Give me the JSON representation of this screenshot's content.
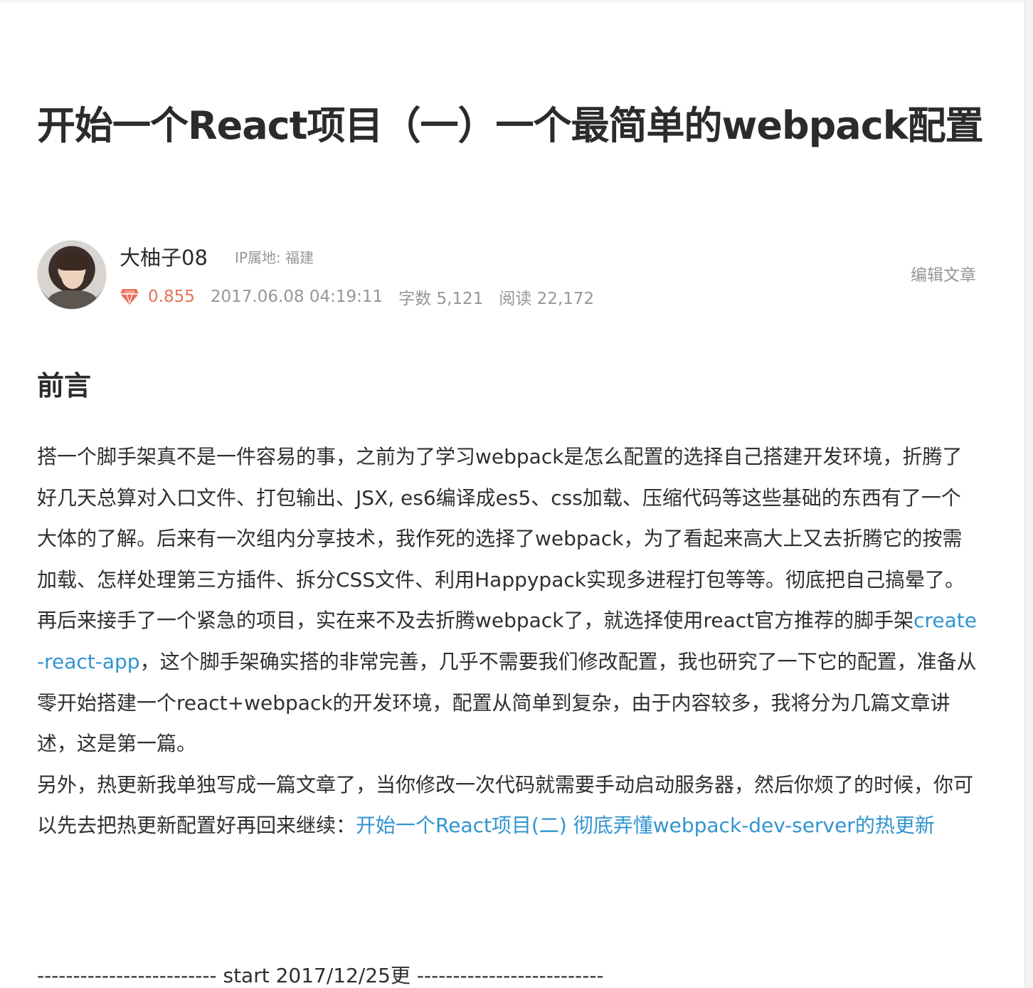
{
  "article": {
    "title": "开始一个React项目（一）一个最简单的webpack配置"
  },
  "author": {
    "name": "大柚子08",
    "ip_location": "IP属地: 福建",
    "score": "0.855",
    "published": "2017.06.08 04:19:11",
    "word_count": "字数 5,121",
    "read_count": "阅读 22,172",
    "edit_label": "编辑文章"
  },
  "section": {
    "heading": "前言",
    "para1_text": "搭一个脚手架真不是一件容易的事，之前为了学习webpack是怎么配置的选择自己搭建开发环境，折腾了好几天总算对入口文件、打包输出、JSX, es6编译成es5、css加载、压缩代码等这些基础的东西有了一个大体的了解。后来有一次组内分享技术，我作死的选择了webpack，为了看起来高大上又去折腾它的按需加载、怎样处理第三方插件、拆分CSS文件、利用Happypack实现多进程打包等等。彻底把自己搞晕了。再后来接手了一个紧急的项目，实在来不及去折腾webpack了，就选择使用react官方推荐的脚手架",
    "para1_link": "create-react-app",
    "para1_tail": "，这个脚手架确实搭的非常完善，几乎不需要我们修改配置，我也研究了一下它的配置，准备从零开始搭建一个react+webpack的开发环境，配置从简单到复杂，由于内容较多，我将分为几篇文章讲述，这是第一篇。",
    "para2_text": "另外，热更新我单独写成一篇文章了，当你修改一次代码就需要手动启动服务器，然后你烦了的时候，你可以先去把热更新配置好再回来继续：",
    "para2_link": "开始一个React项目(二) 彻底弄懂webpack-dev-server的热更新",
    "divider": "------------------------- start 2017/12/25更 --------------------------"
  },
  "colors": {
    "link": "#3194d0",
    "score": "#ea6f5a",
    "muted": "#969696",
    "text": "#2f2f2f"
  },
  "icons": {
    "score_icon": "diamond-icon"
  }
}
